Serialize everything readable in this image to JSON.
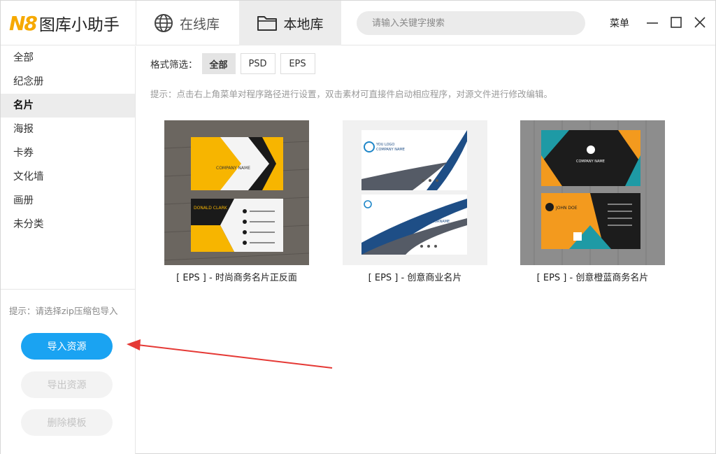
{
  "app": {
    "logo_mark": "N8",
    "title": "图库小助手"
  },
  "tabs": {
    "online": "在线库",
    "local": "本地库"
  },
  "search": {
    "placeholder": "请输入关键字搜索"
  },
  "menu": {
    "label": "菜单"
  },
  "sidebar": {
    "categories": [
      "全部",
      "纪念册",
      "名片",
      "海报",
      "卡券",
      "文化墙",
      "画册",
      "未分类"
    ],
    "active_index": 2,
    "hint": "提示：请选择zip压缩包导入",
    "import_label": "导入资源",
    "export_label": "导出资源",
    "delete_label": "删除模板"
  },
  "filter": {
    "label": "格式筛选：",
    "options": [
      "全部",
      "PSD",
      "EPS"
    ],
    "active": "全部"
  },
  "hint_top": "提示：点击右上角菜单对程序路径进行设置，双击素材可直接件启动相应程序，对源文件进行修改编辑。",
  "cards": [
    {
      "caption": "[ EPS ] - 时尚商务名片正反面",
      "texts": {
        "company": "COMPANY NAME",
        "person": "DONALD CLARK"
      }
    },
    {
      "caption": "[ EPS ] - 创意商业名片",
      "texts": {
        "logo": "YOU LOGO",
        "company": "COMPANY NAME",
        "person": "NAME SURNAME"
      }
    },
    {
      "caption": "[ EPS ] - 创意橙蓝商务名片",
      "texts": {
        "company": "COMPANY NAME",
        "person": "JOHN DOE"
      }
    }
  ],
  "colors": {
    "accent": "#1aa3f2",
    "logo": "#f6a900",
    "arrow": "#e53935",
    "card1_yellow": "#f7b500",
    "card2_blue": "#1e4e86",
    "card3_orange": "#f39a1e",
    "card3_teal": "#1e9aa5"
  }
}
